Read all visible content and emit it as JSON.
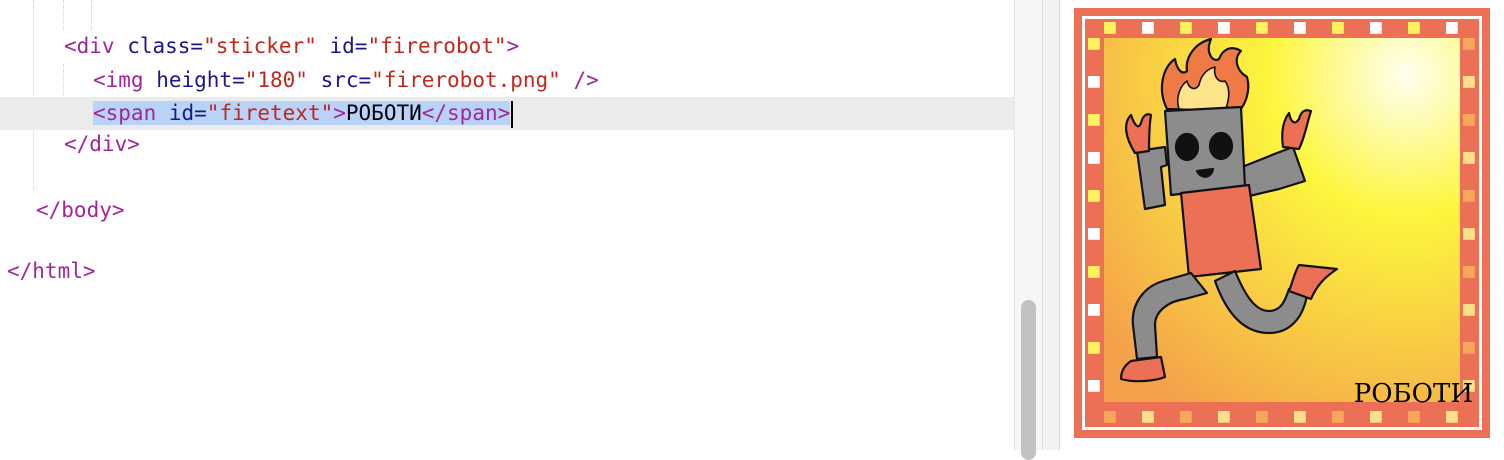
{
  "editor": {
    "lines": [
      {
        "tokens": [
          {
            "t": "<div ",
            "c": "tag"
          },
          {
            "t": "class=",
            "c": "attr"
          },
          {
            "t": "\"sticker\"",
            "c": "val"
          },
          {
            "t": " id=",
            "c": "attr"
          },
          {
            "t": "\"firerobot\"",
            "c": "val"
          },
          {
            "t": ">",
            "c": "tag"
          }
        ]
      },
      {
        "tokens": [
          {
            "t": "<img ",
            "c": "tag"
          },
          {
            "t": "height=",
            "c": "attr"
          },
          {
            "t": "\"180\"",
            "c": "val"
          },
          {
            "t": " src=",
            "c": "attr"
          },
          {
            "t": "\"firerobot.png\"",
            "c": "val"
          },
          {
            "t": " />",
            "c": "tag"
          }
        ]
      },
      {
        "tokens": [
          {
            "t": "<span ",
            "c": "tag",
            "sel": true
          },
          {
            "t": "id=",
            "c": "attr",
            "sel": true
          },
          {
            "t": "\"firetext\"",
            "c": "val",
            "sel": true
          },
          {
            "t": ">",
            "c": "tag",
            "sel": true
          },
          {
            "t": "РОБОТИ",
            "c": "txt",
            "sel": true
          },
          {
            "t": "</span>",
            "c": "tag",
            "sel": true
          }
        ],
        "active": true,
        "caret": true
      },
      {
        "tokens": [
          {
            "t": "</div>",
            "c": "tag"
          }
        ]
      },
      {
        "tokens": []
      },
      {
        "tokens": [
          {
            "t": "</body>",
            "c": "tag"
          }
        ]
      },
      {
        "tokens": []
      },
      {
        "tokens": [
          {
            "t": "</html>",
            "c": "tag"
          }
        ]
      }
    ]
  },
  "preview": {
    "sticker_text": "РОБОТИ"
  },
  "colors": {
    "tag": "#a1269a",
    "attr": "#1c1690",
    "value": "#c1281c",
    "selection": "#b9d2f8",
    "active_line": "#ebebeb",
    "sticker_border": "#ec7055"
  }
}
